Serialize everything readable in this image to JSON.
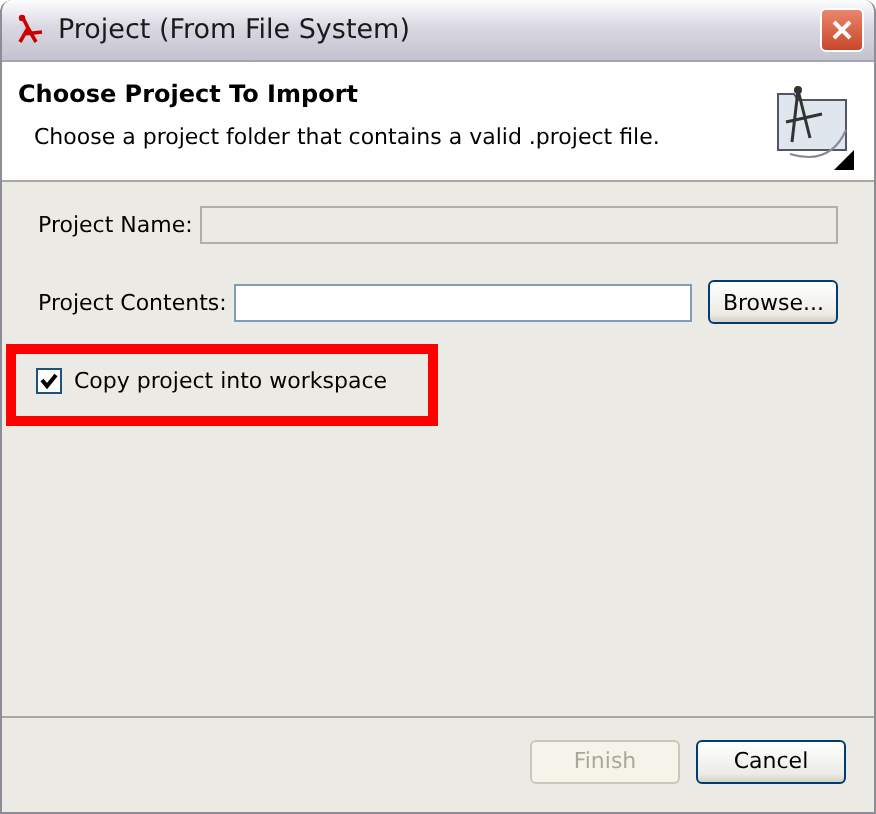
{
  "window": {
    "title": "Project (From File System)"
  },
  "header": {
    "title": "Choose Project To Import",
    "description": "Choose a project folder that contains a valid .project file."
  },
  "fields": [
    {
      "label": "Project Name:",
      "disabled": true
    },
    {
      "label": "Project Contents:",
      "disabled": false,
      "button": "Browse..."
    }
  ],
  "copy_option": {
    "label": "Copy project into workspace",
    "checked": true,
    "highlighted": true
  },
  "buttons": [
    {
      "label": "Finish",
      "disabled": true
    },
    {
      "label": "Cancel",
      "disabled": false
    }
  ]
}
